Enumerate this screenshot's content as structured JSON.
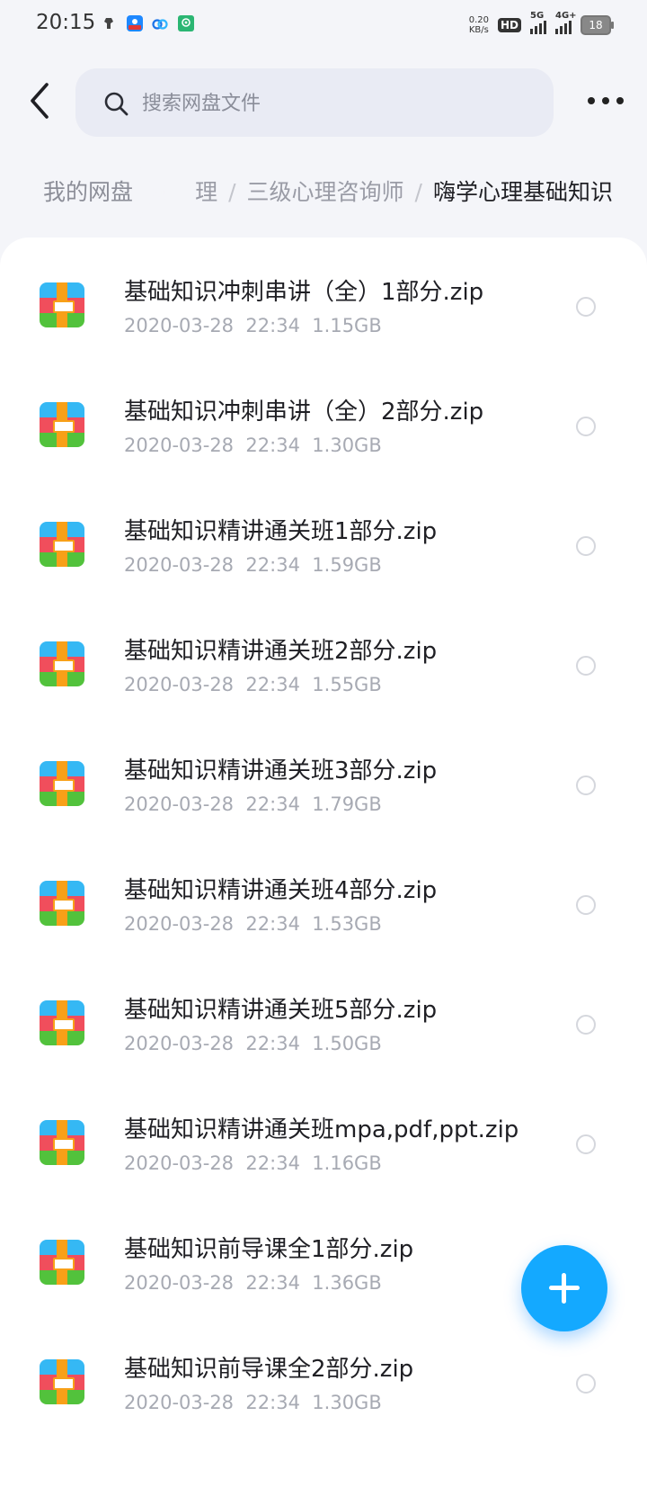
{
  "status_bar": {
    "time": "20:15",
    "net_speed_value": "0.20",
    "net_speed_unit": "KB/s",
    "hd": "HD",
    "sim1_label": "5G",
    "sim2_label": "4G+",
    "battery": "18"
  },
  "header": {
    "search_placeholder": "搜索网盘文件"
  },
  "breadcrumb": {
    "home": "我的网盘",
    "items": [
      "理",
      "三级心理咨询师"
    ],
    "current": "嗨学心理基础知识"
  },
  "files": [
    {
      "name": "基础知识冲刺串讲（全）1部分.zip",
      "date": "2020-03-28",
      "time": "22:34",
      "size": "1.15GB"
    },
    {
      "name": "基础知识冲刺串讲（全）2部分.zip",
      "date": "2020-03-28",
      "time": "22:34",
      "size": "1.30GB"
    },
    {
      "name": "基础知识精讲通关班1部分.zip",
      "date": "2020-03-28",
      "time": "22:34",
      "size": "1.59GB"
    },
    {
      "name": "基础知识精讲通关班2部分.zip",
      "date": "2020-03-28",
      "time": "22:34",
      "size": "1.55GB"
    },
    {
      "name": "基础知识精讲通关班3部分.zip",
      "date": "2020-03-28",
      "time": "22:34",
      "size": "1.79GB"
    },
    {
      "name": "基础知识精讲通关班4部分.zip",
      "date": "2020-03-28",
      "time": "22:34",
      "size": "1.53GB"
    },
    {
      "name": "基础知识精讲通关班5部分.zip",
      "date": "2020-03-28",
      "time": "22:34",
      "size": "1.50GB"
    },
    {
      "name": "基础知识精讲通关班mpa,pdf,ppt.zip",
      "date": "2020-03-28",
      "time": "22:34",
      "size": "1.16GB"
    },
    {
      "name": "基础知识前导课全1部分.zip",
      "date": "2020-03-28",
      "time": "22:34",
      "size": "1.36GB"
    },
    {
      "name": "基础知识前导课全2部分.zip",
      "date": "2020-03-28",
      "time": "22:34",
      "size": "1.30GB"
    }
  ],
  "icons": {
    "file": "zip-archive-icon",
    "back": "chevron-left-icon",
    "search": "search-icon",
    "more": "more-dots-icon",
    "fab": "plus-icon"
  },
  "colors": {
    "accent": "#14a9ff",
    "background": "#f4f5f9",
    "meta_text": "#a7aab3"
  }
}
